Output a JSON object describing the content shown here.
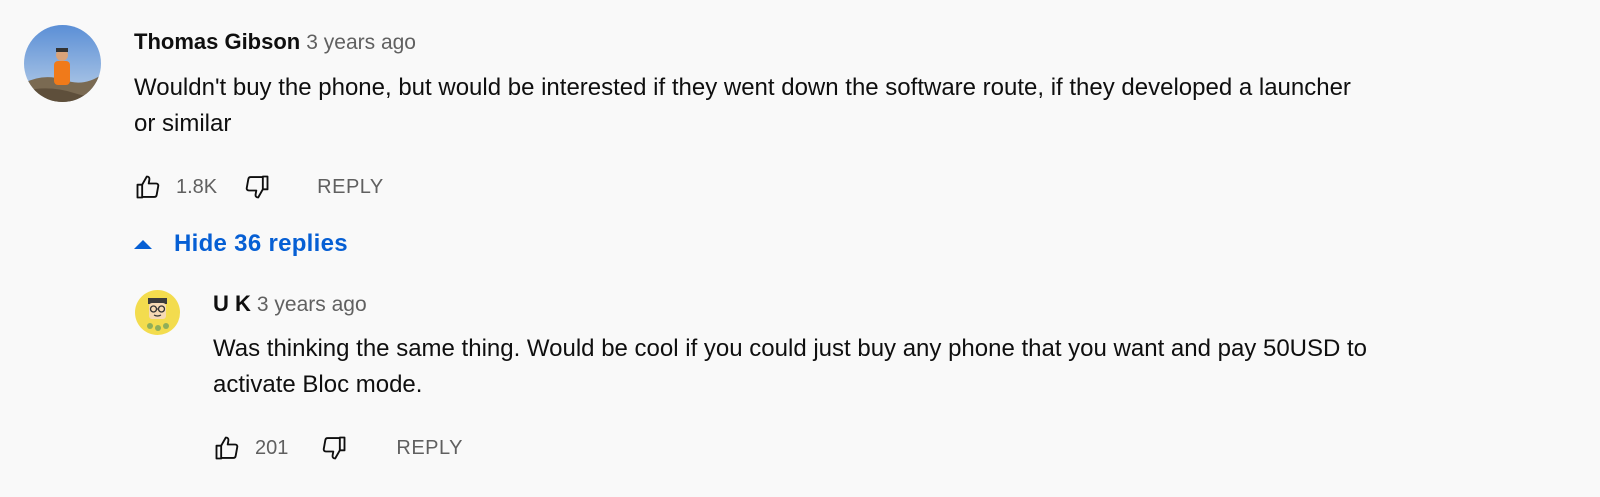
{
  "comments": {
    "top": {
      "author": "Thomas Gibson",
      "time": "3 years ago",
      "text_line1": "Wouldn't buy the phone, but would be interested if they went down the software route, if they developed a launcher",
      "text_line2": "or similar",
      "likes": "1.8K",
      "reply_label": "REPLY",
      "avatar_icon": "person-photo-avatar"
    },
    "replies_toggle": {
      "label": "Hide 36 replies",
      "icon": "caret-up-icon"
    },
    "reply": {
      "author": "U K",
      "time": "3 years ago",
      "text_line1": "Was thinking the same thing. Would be cool if you could just buy any phone that you want and pay 50USD to",
      "text_line2": "activate Bloc mode.",
      "likes": "201",
      "reply_label": "REPLY",
      "avatar_icon": "cartoon-avatar"
    }
  },
  "colors": {
    "background": "#f9f9f9",
    "link": "#065fd4",
    "secondary_text": "#606060"
  }
}
